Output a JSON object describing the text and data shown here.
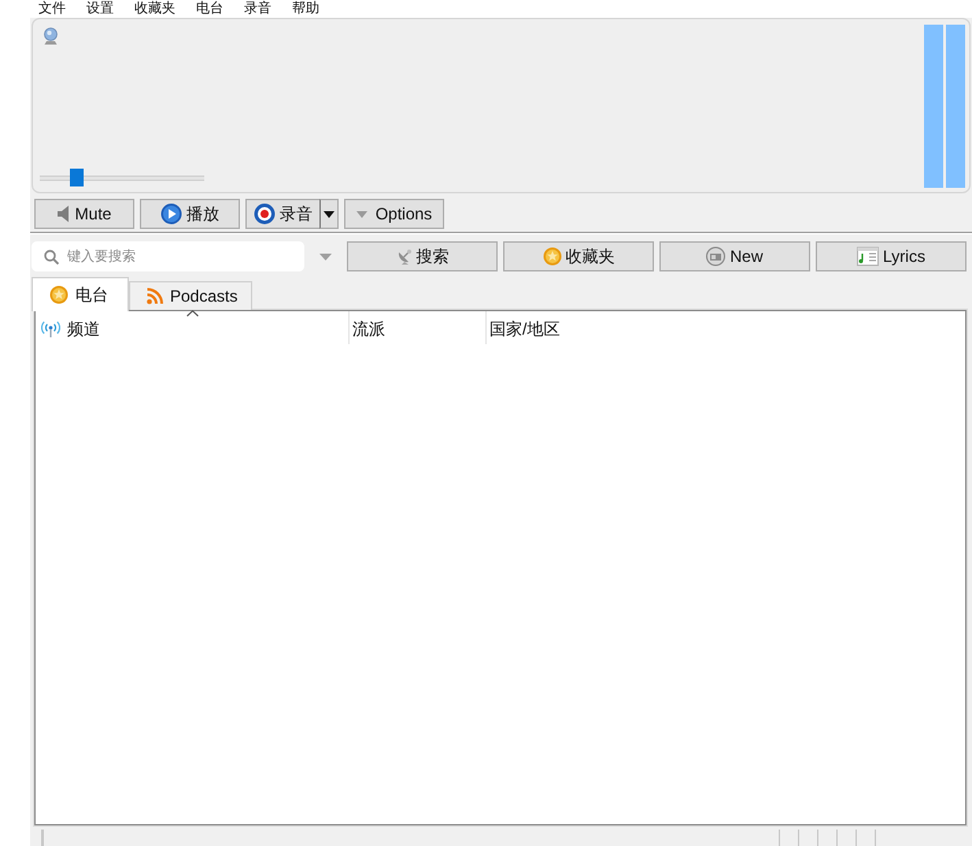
{
  "menu_bar": {
    "items": [
      {
        "label": "文件"
      },
      {
        "label": "设置"
      },
      {
        "label": "收藏夹"
      },
      {
        "label": "电台"
      },
      {
        "label": "录音"
      },
      {
        "label": "帮助"
      }
    ]
  },
  "player": {
    "volume": {
      "level": 0.2
    },
    "meters": [
      {
        "level": 1
      },
      {
        "level": 1
      }
    ]
  },
  "controls": [
    {
      "kind": "mute",
      "label": "Mute",
      "has_menu": false
    },
    {
      "kind": "play",
      "label": "播放",
      "has_menu": false
    },
    {
      "kind": "record",
      "label": "录音",
      "has_menu": true
    },
    {
      "kind": "options",
      "label": "Options",
      "has_menu": false
    }
  ],
  "search": {
    "placeholder": "键入要搜索",
    "buttons": [
      {
        "kind": "search",
        "label": "搜索"
      },
      {
        "kind": "favorites",
        "label": "收藏夹"
      },
      {
        "kind": "new",
        "label": "New"
      },
      {
        "kind": "lyrics",
        "label": "Lyrics"
      }
    ]
  },
  "tabs": [
    {
      "kind": "radio",
      "label": "电台",
      "selected": true
    },
    {
      "kind": "podcasts",
      "label": "Podcasts",
      "selected": false
    }
  ],
  "table": {
    "columns": [
      {
        "label": "频道",
        "sorted": true
      },
      {
        "label": "流派",
        "sorted": false
      },
      {
        "label": "国家/地区",
        "sorted": false
      }
    ]
  }
}
